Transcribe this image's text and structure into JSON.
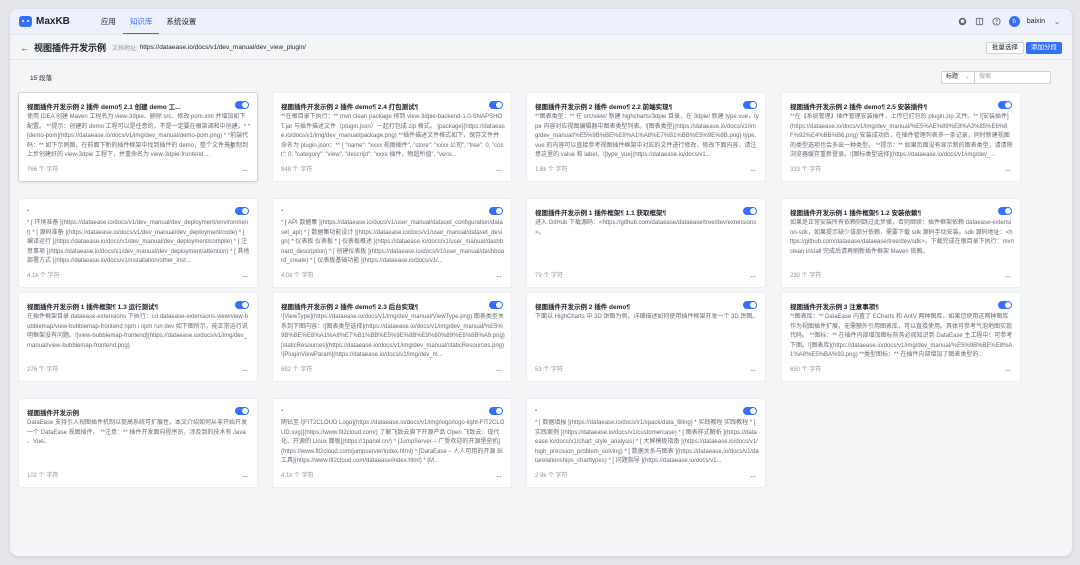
{
  "app": {
    "logo_text": "MaxKB",
    "nav": [
      "应用",
      "知识库",
      "系统设置"
    ],
    "active_nav": 1,
    "username": "baixin",
    "avatar_letter": "b",
    "icons": [
      "github-icon",
      "book-icon",
      "help-icon"
    ]
  },
  "header": {
    "back": "←",
    "title": "视图插件开发示例",
    "doc_addr_label": "文档地址:",
    "doc_addr": "https://dataease.io/docs/v1/dev_manual/dev_view_plugin/",
    "batch_select": "批量选择",
    "add_segment": "添加分段"
  },
  "toolbar": {
    "count": "15 段落",
    "filter_label": "标题",
    "search_placeholder": "搜索"
  },
  "cards": [
    {
      "title": "视图插件开发示例 2 插件 demo¶ 2.1 创建 demo 工...",
      "body": "使用 IDEA 创建 Maven 工程名为 view-3dpie、删除 src、修改 pom.xml 并增加如下配置。 **提示：创建的 demo 工程可以是任意的，不是一定要在根架调和中创建。* * [demo-pom](https://dataease.io/docs/v1/img/dev_manual/demo-pom.png) * *前端代码：** 如下示例图，在前面下新的插件框架中找到插件的 demo，整个文件夹复制到上步创建好的 view-3dpie 工程下，并重命名为 view-3dpie-frontend ...",
      "foot": "766 个 字符"
    },
    {
      "title": "视图插件开发示例 2 插件 demo¶ 2.4 打包测试¶",
      "body": "**在根目录下执行：** mvn clean package 得到 view-3dpie-backend-1.0-SNAPSHOT.jar 与插件描述文件（plugin.json）一起打包成 zip 格式。 [package](https://dataease.io/docs/v1/img/dev_manual/package.png) **插件描述文件格式如下，保存文件并命名为 plugin.json：** { \"name\": \"xxxx 视图插件\", \"store\": \"xxxx 公司\", \"free\": 0, \"cost\": 0, \"category\": \"view\", \"descript\": \"xxxx 插件，物超所值\", \"versi...",
      "foot": "848 个 字符"
    },
    {
      "title": "视图插件开发示例 2 插件 demo¶ 2.2 前端实现¶",
      "body": "**图表类型：** 在 src/view/ 新建 highcharts/3dpie 目录，在 3dpie/ 新建 type.vue，type 内容对应视图编辑器中图表类型列表。![图表类型](https://dataease.io/docs/v1/img/dev_manual/%E5%9B%BE%E8%A1%A8%E7%B1%BB%E5%9E%8B.png) type.vue 的内容可以直接参考视图插件框架中对应的文件进行修改，修改下面内容，请注意这里的 value 和 label，![type_vue](https://dataease.io/docs/v1...",
      "foot": "1.6k 个 字符"
    },
    {
      "title": "视图插件开发示例 2 插件 demo¶ 2.5 安装插件¶",
      "body": "**在【系统管理】插件管理安装插件，上传已打包的 plugin.zip 文件。** ![安装插件](https://dataease.io/docs/v1/img/dev_manual/%E5%AE%89%E8%A3%85%E6%8F%92%E4%BB%B6.png) 安装成功后，在插件管理列表多一条记录，同时新建视图的类型选项也会多出一种类型。 **提示：** 如果页面没有显示新的图表类型，请清除浏览器缓存重新登录。![图标类型选择](https://dataease.io/docs/v1/img/dev_...",
      "foot": "333 个 字符"
    },
    {
      "title": "-",
      "body": "* [ 环境准备 ](https://dataease.io/docs/v1/dev_manual/dev_deployment/environment) * [ 源码准备 ](https://dataease.io/docs/v1/dev_manual/dev_deployment/code) * [ 编译运行 ](https://dataease.io/docs/v1/dev_manual/dev_deployment/compile) * [ 注意事项 ](https://dataease.io/docs/v1/dev_manual/dev_deployment/attention) * [ 其他部署方式 ](https://dataease.io/docs/v1/installation/other_inst...",
      "foot": "4.1k 个 字符"
    },
    {
      "title": "-",
      "body": "* [ API 数据集 ](https://dataease.io/docs/v1/user_manual/dataset_configuration/dataset_api) * [ 数据集功能设计 ](https://dataease.io/docs/v1/user_manual/dataset_design) * 仪表板 仪表板 * [ 仪表板概述 ](https://dataease.io/docs/v1/user_manual/dashboard_description) * [ 创建仪表板 ](https://dataease.io/docs/v1/user_manual/dashboard_create) * [ 仪表板基础功能 ](https://dataease.io/docs/v1/...",
      "foot": "4.0k 个 字符"
    },
    {
      "title": "视图插件开发示例 1 插件框架¶ 1.1 获取框架¶",
      "body": "进入 GitHub 下载源码：<https://github.com/dataease/dataease/tree/dev/extensions>。",
      "foot": "79 个 字符"
    },
    {
      "title": "视图插件开发示例 1 插件框架¶ 1.2 安装依赖¶",
      "body": "如果是正常安装所有依赖则跳过此步骤，否则继续：插件框架依赖 dataease-extension-sdk，如果提示缺少该部分依赖，需要下载 sdk 源码手动安装。sdk 源码地址：<https://github.com/dataease/dataease/tree/dev/sdk>。下载完成在根目录下执行：mvn clean install 完成后请再刷新插件框架 Maven 依赖。",
      "foot": "230 个 字符"
    },
    {
      "title": "视图插件开发示例 1 插件框架¶ 1.3 运行测试¶",
      "body": "在插件框架目录 dataease-extensions 下执行：cd dataease-extensions-view/view-bubblemap/view-bubblemap-frontend npm i npm run dev 如下图所示，能正常运行说明框架没有问题。![view-bubblemap-frontend](https://dataease.io/docs/v1/img/dev_manual/view-bubblemap-frontend.png)",
      "foot": "276 个 字符"
    },
    {
      "title": "视图插件开发示例 2 插件 demo¶ 2.3 后台实现¶",
      "body": "![ViewType](https://dataease.io/docs/v1/img/dev_manual/ViewType.png) 图表类型关系到下图内容：![图表类型选择](https://dataease.io/docs/v1/img/dev_manual/%E5%9B%BE%E8%A1%A8%E7%B1%BB%E5%9E%8B%E9%80%89%E6%8B%A9.png) [staticResources](https://dataease.io/docs/v1/img/dev_manual/staticResources.png) ![PluginViewParam](https://dataease.io/docs/v1/img/dev_m...",
      "foot": "682 个 字符"
    },
    {
      "title": "视图插件开发示例 2 插件 demo¶",
      "body": "下面以 HighCharts 中 3D 饼图为例，详细描述如何使用插件框架开发一个 3D 饼图。",
      "foot": "53 个 字符"
    },
    {
      "title": "视图插件开发示例 3 注意事项¶",
      "body": "**图表库：** DataEase 内置了 ECharts 和 AntV 两种图库，如果您使用这两种图库作为视图插件扩展，无需额外引用图表库，可以直接使用。具体可参考气泡地图实现代码。 **图标：** 在插件内部增加图标前务必阅知识到 DataEase 主工程中！可参考下图。![图表库](https://dataease.io/docs/v1/img/dev_manual/%E5%9B%BE%E8%A1%A8%E5%BA%93.png) **类型图标：** 在插件内部增加了图表类型的...",
      "foot": "650 个 字符"
    },
    {
      "title": "视图插件开发示例",
      "body": "DataEase 支持引入视图插件机制以提高系统可扩展性。本文介绍如何从零开始开发一个 DataEase 视图插件。 **注意：** 插件开发面向程序员，涉及到的技术有 Java 、Vue。",
      "foot": "102 个 字符"
    },
    {
      "title": "-",
      "body": "随钻至 ![FIT2CLOUD Logo](https://dataease.io/docs/v1/img/logo/logo-light-FIT2CLOUD.svg)](https://www.fit2cloud.com/) 了解飞致云旗下开源产品 Open 飞致云：现代化、开源的 Linux 面板](https://1panel.cn/) * [JumpServer – 广受欢迎的开源堡垒机](https://www.fit2cloud.com/jumpserver/index.html) * [DataEase – 人人可用的开源 BI 工具](https://www.fit2cloud.com/dataease/index.html) * [M...",
      "foot": "4.1k 个 字符"
    },
    {
      "title": "-",
      "body": "* [ 数据填报 ](https://dataease.io/docs/v1/xpack/data_filling) * 实践教程 实践教程 * [ 实践案例 ](https://dataease.io/docs/v1/customercase) * [ 图表样式解析 ](https://dataease.io/docs/v1/chart_style_analysis) * [ 大屏模板指南 ](https://dataease.io/docs/v1/high_precision_problem_solving) * [ 数据关系与图表 ](https://dataease.io/docs/v1/datarelationships_charttypes) * [ 问题指导 ](https://dataease.io/docs/v1...",
      "foot": "2.9k 个 字符"
    }
  ],
  "more_glyph": "···",
  "colors": {
    "accent": "#3370ff",
    "bg": "#f4f5f7",
    "card": "#ffffff"
  }
}
